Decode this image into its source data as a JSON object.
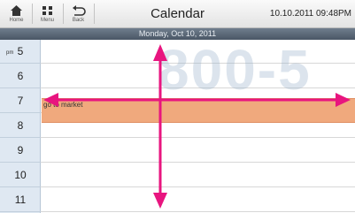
{
  "toolbar": {
    "home_label": "Home",
    "menu_label": "Menu",
    "back_label": "Back"
  },
  "header": {
    "title": "Calendar",
    "datetime": "10.10.2011 09:48PM"
  },
  "date_bar": "Monday, Oct 10, 2011",
  "watermark": "800-5",
  "hours": {
    "ampm": "pm",
    "labels": [
      "5",
      "6",
      "7",
      "8",
      "9",
      "10",
      "11"
    ]
  },
  "event": {
    "title": "go to market"
  },
  "colors": {
    "event_bg": "#f0a97d",
    "arrows": "#e8157f",
    "date_bar": "#5c6878"
  }
}
